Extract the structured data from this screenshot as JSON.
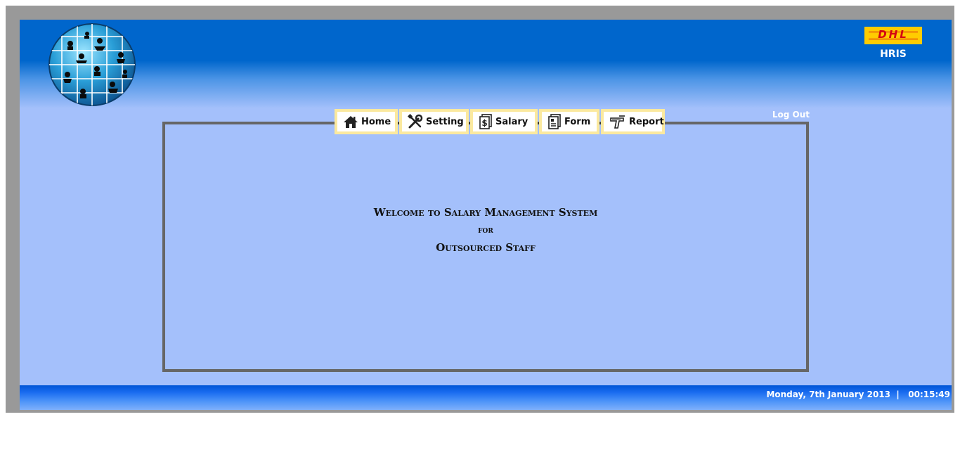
{
  "header": {
    "logo_label": "DHL",
    "system_name": "HRIS"
  },
  "nav": {
    "tabs": [
      {
        "label": "Home",
        "icon": "home-icon"
      },
      {
        "label": "Setting",
        "icon": "tools-icon"
      },
      {
        "label": "Salary",
        "icon": "dollar-document-icon"
      },
      {
        "label": "Form",
        "icon": "form-document-icon"
      },
      {
        "label": "Report",
        "icon": "report-icon"
      }
    ],
    "logout_label": "Log Out"
  },
  "main": {
    "welcome_line1": "Welcome to Salary Management System",
    "welcome_line2": "for",
    "welcome_line3": "Outsourced Staff"
  },
  "footer": {
    "date": "Monday, 7th January 2013",
    "separator": "|",
    "time": "00:15:49"
  },
  "colors": {
    "header_blue": "#0066cc",
    "page_background": "#a4c0fb",
    "tab_border": "#fbe99f",
    "dhl_yellow": "#ffcc00",
    "dhl_red": "#d40511",
    "frame_gray": "#999999"
  }
}
